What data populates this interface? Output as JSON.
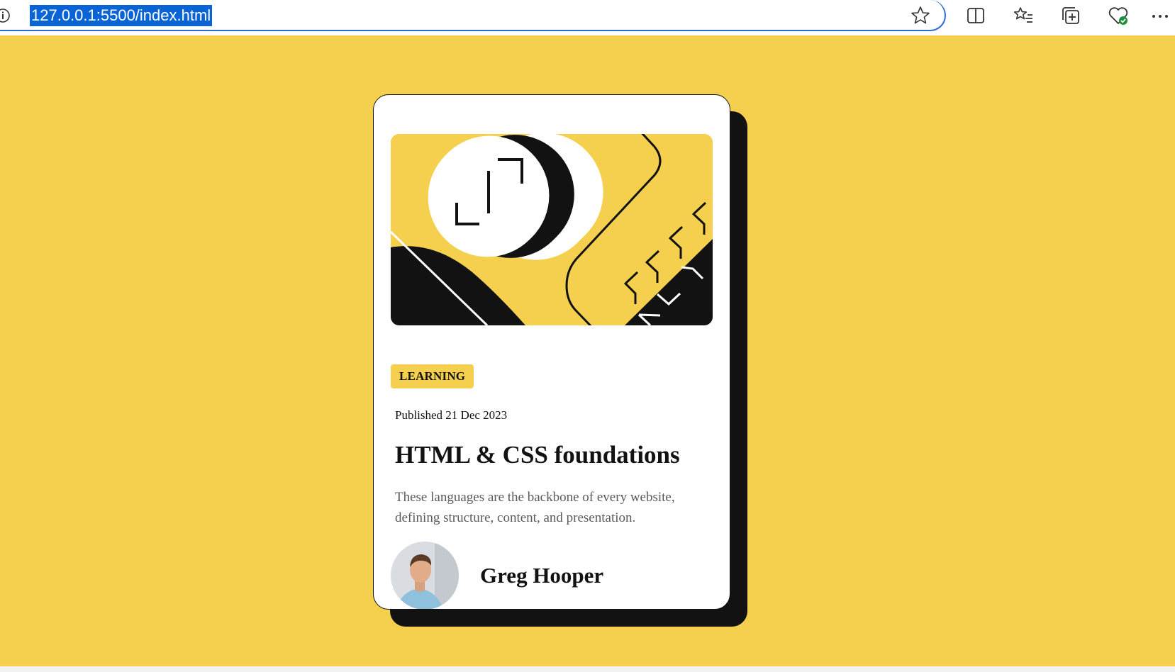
{
  "browser": {
    "url": "127.0.0.1:5500/index.html",
    "icons": [
      "info-icon",
      "favorite-star-icon",
      "split-screen-icon",
      "favorites-list-icon",
      "collections-icon",
      "browser-essentials-icon",
      "more-options-icon"
    ],
    "accent": "#2a6ad8"
  },
  "page": {
    "background": "#f4d04e"
  },
  "card": {
    "tag": "LEARNING",
    "published": "Published 21 Dec 2023",
    "title": "HTML & CSS foundations",
    "description": "These languages are the backbone of every website, defining structure, content, and presentation.",
    "author_name": "Greg Hooper",
    "colors": {
      "surface": "#ffffff",
      "ink": "#121212",
      "accent": "#f4d04e",
      "muted": "#5a5a5a"
    }
  }
}
